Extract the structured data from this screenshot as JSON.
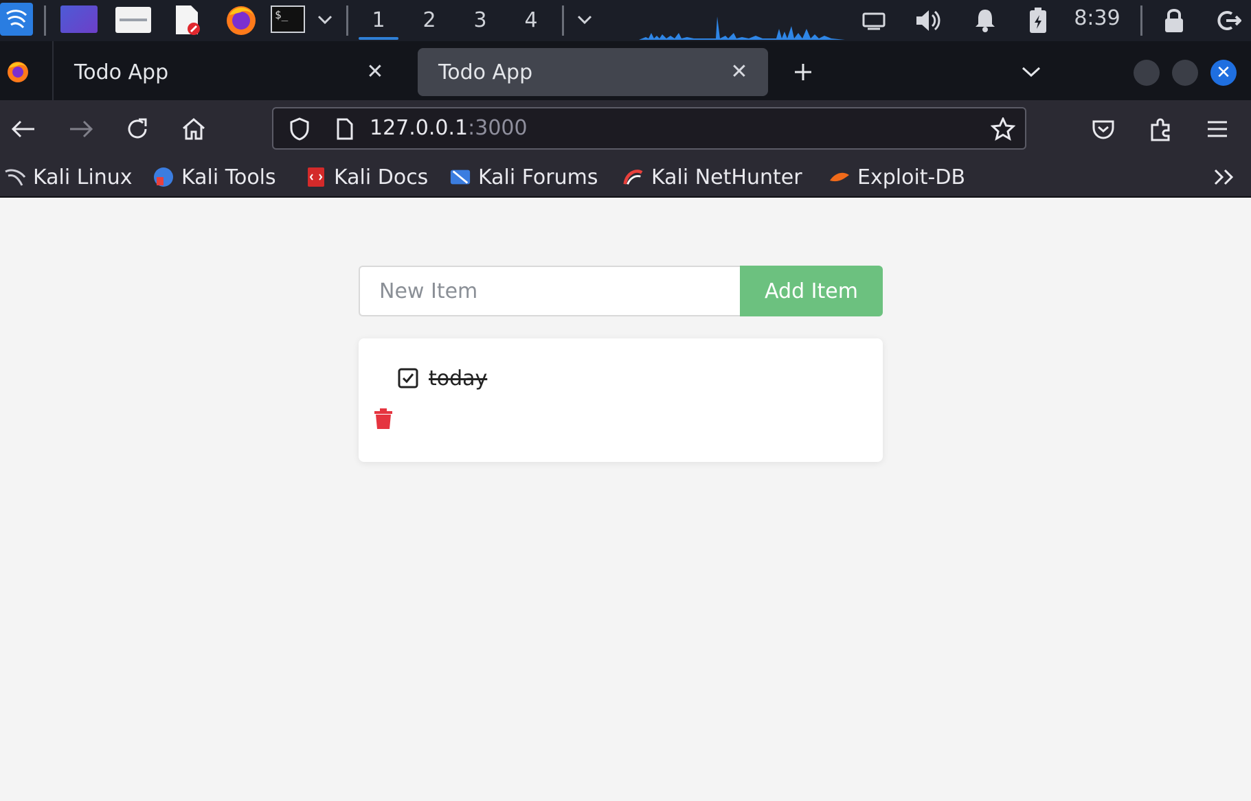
{
  "taskbar": {
    "workspaces": [
      "1",
      "2",
      "3",
      "4"
    ],
    "active_workspace": "1",
    "clock": "8:39",
    "icons": [
      "kali-menu-icon",
      "desktop-icon",
      "file-manager-icon",
      "text-editor-icon",
      "firefox-icon",
      "terminal-icon",
      "chevron-down-icon",
      "network-icon",
      "volume-icon",
      "bell-icon",
      "battery-icon",
      "lock-icon",
      "logout-icon"
    ]
  },
  "browser": {
    "tabs": [
      {
        "title": "Todo App",
        "active": false
      },
      {
        "title": "Todo App",
        "active": true
      }
    ],
    "url_host": "127.0.0.1",
    "url_port": ":3000",
    "bookmarks": [
      "Kali Linux",
      "Kali Tools",
      "Kali Docs",
      "Kali Forums",
      "Kali NetHunter",
      "Exploit-DB"
    ],
    "accent": "#1f6fe0"
  },
  "app": {
    "input_placeholder": "New Item",
    "input_value": "",
    "add_button_label": "Add Item",
    "add_button_color": "#6cc17f",
    "items": [
      {
        "text": "today",
        "completed": true
      }
    ],
    "delete_color": "#e5343f"
  }
}
